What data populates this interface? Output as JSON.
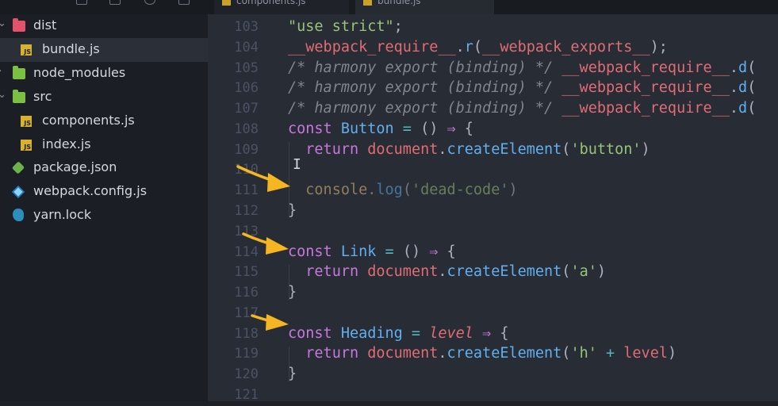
{
  "tabs": [
    {
      "label": "components.js"
    },
    {
      "label": "bundle.js"
    }
  ],
  "sidebar": {
    "items": [
      {
        "label": "dist",
        "icon": "folder-red-icon",
        "chevron": "⌄"
      },
      {
        "label": "bundle.js",
        "icon": "js-file-icon"
      },
      {
        "label": "node_modules",
        "icon": "folder-green-icon",
        "chevron": "›"
      },
      {
        "label": "src",
        "icon": "folder-green-icon",
        "chevron": "⌄"
      },
      {
        "label": "components.js",
        "icon": "js-file-icon"
      },
      {
        "label": "index.js",
        "icon": "js-file-icon"
      },
      {
        "label": "package.json",
        "icon": "nodejs-icon"
      },
      {
        "label": "webpack.config.js",
        "icon": "webpack-icon"
      },
      {
        "label": "yarn.lock",
        "icon": "yarn-icon"
      }
    ]
  },
  "editor": {
    "lines": [
      {
        "n": "103",
        "tokens": [
          [
            "str",
            "\"use strict\""
          ],
          [
            "plain",
            ";"
          ]
        ]
      },
      {
        "n": "104",
        "tokens": [
          [
            "red",
            "__webpack_require__"
          ],
          [
            "plain",
            "."
          ],
          [
            "fn",
            "r"
          ],
          [
            "plain",
            "("
          ],
          [
            "red",
            "__webpack_exports__"
          ],
          [
            "plain",
            ");"
          ]
        ]
      },
      {
        "n": "105",
        "tokens": [
          [
            "cm",
            "/* harmony export (binding) */ "
          ],
          [
            "red",
            "__webpack_require__"
          ],
          [
            "plain",
            "."
          ],
          [
            "fn",
            "d"
          ],
          [
            "plain",
            "("
          ]
        ]
      },
      {
        "n": "106",
        "tokens": [
          [
            "cm",
            "/* harmony export (binding) */ "
          ],
          [
            "red",
            "__webpack_require__"
          ],
          [
            "plain",
            "."
          ],
          [
            "fn",
            "d"
          ],
          [
            "plain",
            "("
          ]
        ]
      },
      {
        "n": "107",
        "tokens": [
          [
            "cm",
            "/* harmony export (binding) */ "
          ],
          [
            "red",
            "__webpack_require__"
          ],
          [
            "plain",
            "."
          ],
          [
            "fn",
            "d"
          ],
          [
            "plain",
            "("
          ]
        ]
      },
      {
        "n": "108",
        "tokens": [
          [
            "kw",
            "const "
          ],
          [
            "fn",
            "Button"
          ],
          [
            "op",
            " = "
          ],
          [
            "plain",
            "() "
          ],
          [
            "kw",
            "⇒"
          ],
          [
            "plain",
            " {"
          ]
        ]
      },
      {
        "n": "109",
        "tokens": [
          [
            "plain",
            "  "
          ],
          [
            "kw",
            "return "
          ],
          [
            "obj",
            "document"
          ],
          [
            "plain",
            "."
          ],
          [
            "fn",
            "createElement"
          ],
          [
            "plain",
            "("
          ],
          [
            "str",
            "'button'"
          ],
          [
            "plain",
            ")"
          ]
        ]
      },
      {
        "n": "110",
        "tokens": [
          [
            "plain",
            ""
          ]
        ]
      },
      {
        "n": "111",
        "tokens": [
          [
            "plain",
            "  "
          ],
          [
            "str2",
            "console"
          ],
          [
            "plain",
            "."
          ],
          [
            "fn",
            "log"
          ],
          [
            "plain",
            "("
          ],
          [
            "str",
            "'dead-code'"
          ],
          [
            "plain",
            ")"
          ]
        ],
        "dim": true
      },
      {
        "n": "112",
        "tokens": [
          [
            "plain",
            "}"
          ]
        ]
      },
      {
        "n": "113",
        "tokens": [
          [
            "plain",
            ""
          ]
        ]
      },
      {
        "n": "114",
        "tokens": [
          [
            "kw",
            "const "
          ],
          [
            "fn",
            "Link"
          ],
          [
            "op",
            " = "
          ],
          [
            "plain",
            "() "
          ],
          [
            "kw",
            "⇒"
          ],
          [
            "plain",
            " {"
          ]
        ]
      },
      {
        "n": "115",
        "tokens": [
          [
            "plain",
            "  "
          ],
          [
            "kw",
            "return "
          ],
          [
            "obj",
            "document"
          ],
          [
            "plain",
            "."
          ],
          [
            "fn",
            "createElement"
          ],
          [
            "plain",
            "("
          ],
          [
            "str",
            "'a'"
          ],
          [
            "plain",
            ")"
          ]
        ]
      },
      {
        "n": "116",
        "tokens": [
          [
            "plain",
            "}"
          ]
        ]
      },
      {
        "n": "117",
        "tokens": [
          [
            "plain",
            ""
          ]
        ]
      },
      {
        "n": "118",
        "tokens": [
          [
            "kw",
            "const "
          ],
          [
            "fn",
            "Heading"
          ],
          [
            "op",
            " = "
          ],
          [
            "param",
            "level"
          ],
          [
            "kw",
            " ⇒"
          ],
          [
            "plain",
            " {"
          ]
        ]
      },
      {
        "n": "119",
        "tokens": [
          [
            "plain",
            "  "
          ],
          [
            "kw",
            "return "
          ],
          [
            "obj",
            "document"
          ],
          [
            "plain",
            "."
          ],
          [
            "fn",
            "createElement"
          ],
          [
            "plain",
            "("
          ],
          [
            "str",
            "'h'"
          ],
          [
            "op",
            " + "
          ],
          [
            "red",
            "level"
          ],
          [
            "plain",
            ")"
          ]
        ]
      },
      {
        "n": "120",
        "tokens": [
          [
            "plain",
            "}"
          ]
        ]
      },
      {
        "n": "121",
        "tokens": [
          [
            "plain",
            ""
          ]
        ]
      }
    ]
  },
  "colors": {
    "annotation_arrow": "#f5b622",
    "sidebar_bg": "#1b1e24",
    "editor_bg": "#282c34"
  }
}
